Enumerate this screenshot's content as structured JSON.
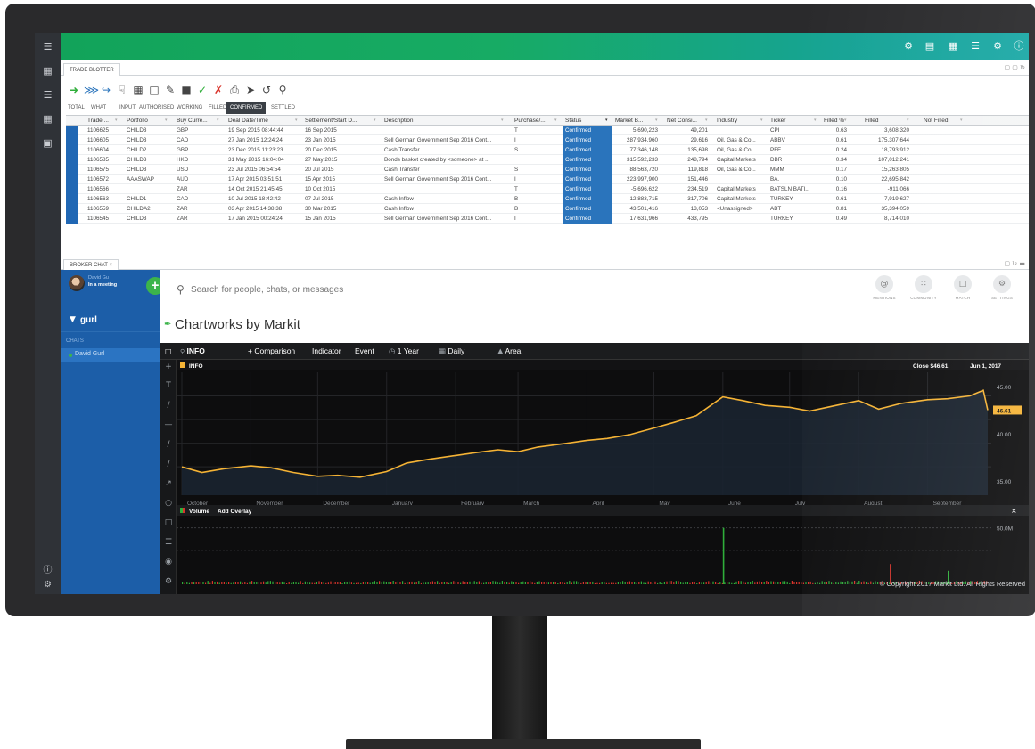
{
  "leftnav": {
    "icons": [
      "menu-icon",
      "grid-icon",
      "list-icon",
      "table-icon",
      "folder-icon"
    ],
    "bottom_icons": [
      "info-icon",
      "settings-icon"
    ]
  },
  "topbar": {
    "icons": [
      "settings-icon",
      "save-icon",
      "layout-icon",
      "filter-icon",
      "users-settings-icon",
      "info-icon",
      "user-icon"
    ],
    "gradient_start": "#12a35a",
    "gradient_end": "#1aa8a6"
  },
  "blotter": {
    "tab_label": "TRADE BLOTTER",
    "subtabs": [
      "TOTAL",
      "WHAT IF",
      "INPUT",
      "AUTHORISED",
      "WORKING",
      "FILLED",
      "CONFIRMED",
      "SETTLED"
    ],
    "active_subtab": "CONFIRMED",
    "columns": [
      "Trade ...",
      "Portfolio",
      "Buy Curre...",
      "Deal Date/Time",
      "Settlement/Start D...",
      "Description",
      "Purchase/...",
      "Status",
      "Market B...",
      "Net Consi...",
      "Industry",
      "Ticker",
      "Filled %",
      "Filled",
      "Not Filled"
    ],
    "rows": [
      [
        "1106625",
        "CHILD3",
        "GBP",
        "19 Sep 2015 08:44:44",
        "16 Sep 2015",
        "",
        "T",
        "Confirmed",
        "5,690,223",
        "49,201",
        "",
        "CPI",
        "0.63",
        "3,608,320",
        ""
      ],
      [
        "1106605",
        "CHILD3",
        "CAD",
        "27 Jan 2015 12:24:24",
        "23 Jan 2015",
        "Sell German Government Sep 2016 Cont...",
        "I",
        "Confirmed",
        "287,934,960",
        "29,616",
        "Oil, Gas & Co...",
        "ABBV",
        "0.61",
        "175,307,644",
        ""
      ],
      [
        "1106604",
        "CHILD2",
        "GBP",
        "23 Dec 2015 11:23:23",
        "20 Dec 2015",
        "Cash Transfer",
        "S",
        "Confirmed",
        "77,346,148",
        "135,698",
        "Oil, Gas & Co...",
        "PFE",
        "0.24",
        "18,793,912",
        ""
      ],
      [
        "1106585",
        "CHILD3",
        "HKD",
        "31 May 2015 16:04:04",
        "27 May 2015",
        "Bonds basket created by <someone> at ...",
        "",
        "Confirmed",
        "315,592,233",
        "248,794",
        "Capital Markets",
        "DBR",
        "0.34",
        "107,012,241",
        ""
      ],
      [
        "1106575",
        "CHILD3",
        "USD",
        "23 Jul 2015 06:54:54",
        "20 Jul 2015",
        "Cash Transfer",
        "S",
        "Confirmed",
        "88,563,720",
        "119,818",
        "Oil, Gas & Co...",
        "MMM",
        "0.17",
        "15,263,805",
        ""
      ],
      [
        "1106572",
        "AAASWAP",
        "AUD",
        "17 Apr 2015 03:51:51",
        "15 Apr 2015",
        "Sell German Government Sep 2016 Cont...",
        "I",
        "Confirmed",
        "223,997,900",
        "151,446",
        "",
        "BA.",
        "0.10",
        "22,695,842",
        ""
      ],
      [
        "1106566",
        "",
        "ZAR",
        "14 Oct 2015 21:45:45",
        "10 Oct 2015",
        "",
        "T",
        "Confirmed",
        "-5,696,622",
        "234,519",
        "Capital Markets",
        "BATSLN BATI...",
        "0.16",
        "-911,066",
        ""
      ],
      [
        "1106563",
        "CHILD1",
        "CAD",
        "10 Jul 2015 18:42:42",
        "07 Jul 2015",
        "Cash Inflow",
        "B",
        "Confirmed",
        "12,883,715",
        "317,706",
        "Capital Markets",
        "TURKEY",
        "0.61",
        "7,919,627",
        ""
      ],
      [
        "1106559",
        "CHILDA2",
        "ZAR",
        "03 Apr 2015 14:38:38",
        "30 Mar 2015",
        "Cash Inflow",
        "B",
        "Confirmed",
        "43,501,416",
        "13,053",
        "<Unassigned>",
        "ABT",
        "0.81",
        "35,394,059",
        ""
      ],
      [
        "1106545",
        "CHILD3",
        "ZAR",
        "17 Jan 2015 00:24:24",
        "15 Jan 2015",
        "Sell German Government Sep 2016 Cont...",
        "I",
        "Confirmed",
        "17,631,966",
        "433,795",
        "",
        "TURKEY",
        "0.49",
        "8,714,010",
        ""
      ]
    ]
  },
  "chat": {
    "tab_label": "BROKER CHAT",
    "user_name": "David Gu",
    "user_status": "In a meeting",
    "search_query": "gurl",
    "section_label": "CHATS",
    "contact": "David Gurl",
    "search_placeholder": "Search for people, chats, or messages",
    "actions": [
      "MENTIONS",
      "COMMUNITY",
      "MATCH",
      "SETTINGS"
    ]
  },
  "chartworks": {
    "brand": "Chartworks by Markit",
    "toolbar": {
      "symbol": "INFO",
      "comparison": "+ Comparison",
      "indicator": "Indicator",
      "event": "Event",
      "range": "1 Year",
      "interval": "Daily",
      "type": "Area"
    },
    "legend_symbol": "INFO",
    "close_label": "Close $46.61",
    "close_date": "Jun 1, 2017",
    "last_price": "46.61",
    "volume_label": "Volume",
    "add_overlay": "Add Overlay",
    "volume_tick": "50.0M",
    "copyright": "© Copyright 2017 Markit Ltd. All Rights Reserved",
    "line_color": "#f5b335",
    "up_color": "#2fae3a",
    "down_color": "#d9342b"
  },
  "chart_data": {
    "type": "line",
    "title": "INFO",
    "x": [
      "2016-10-01",
      "2016-10-10",
      "2016-10-20",
      "2016-11-01",
      "2016-11-10",
      "2016-11-20",
      "2016-12-01",
      "2016-12-10",
      "2016-12-20",
      "2017-01-01",
      "2017-01-10",
      "2017-01-20",
      "2017-02-01",
      "2017-02-10",
      "2017-02-20",
      "2017-03-01",
      "2017-03-10",
      "2017-03-20",
      "2017-04-01",
      "2017-04-10",
      "2017-04-20",
      "2017-05-01",
      "2017-05-10",
      "2017-05-20",
      "2017-06-01",
      "2017-06-10",
      "2017-06-20",
      "2017-07-01",
      "2017-07-10",
      "2017-07-20",
      "2017-08-01",
      "2017-08-10",
      "2017-08-20",
      "2017-09-01",
      "2017-09-10",
      "2017-09-20",
      "2017-09-26",
      "2017-09-28"
    ],
    "series": [
      {
        "name": "INFO",
        "values": [
          36.5,
          35.9,
          36.3,
          36.6,
          36.4,
          35.9,
          35.5,
          35.6,
          35.4,
          36.0,
          36.9,
          37.3,
          37.7,
          38.0,
          38.3,
          38.1,
          38.6,
          38.9,
          39.3,
          39.5,
          39.9,
          40.6,
          41.2,
          41.9,
          43.9,
          43.5,
          43.0,
          42.8,
          42.4,
          42.9,
          43.5,
          42.6,
          43.2,
          43.6,
          43.7,
          44.0,
          44.6,
          42.5
        ]
      }
    ],
    "x_ticks": [
      "October 2016",
      "November",
      "December",
      "January 2017",
      "February",
      "March",
      "April",
      "May",
      "June",
      "July",
      "August",
      "September"
    ],
    "y_ticks": [
      35.0,
      40.0,
      45.0
    ],
    "ylim": [
      33.5,
      46.5
    ],
    "grid": true,
    "volume_ylim_millions": [
      0,
      60
    ],
    "volume_spikes_millions": [
      {
        "date": "2017-06-01",
        "value": 50
      },
      {
        "date": "2017-08-15",
        "value": 18
      },
      {
        "date": "2017-09-10",
        "value": 12
      }
    ]
  }
}
